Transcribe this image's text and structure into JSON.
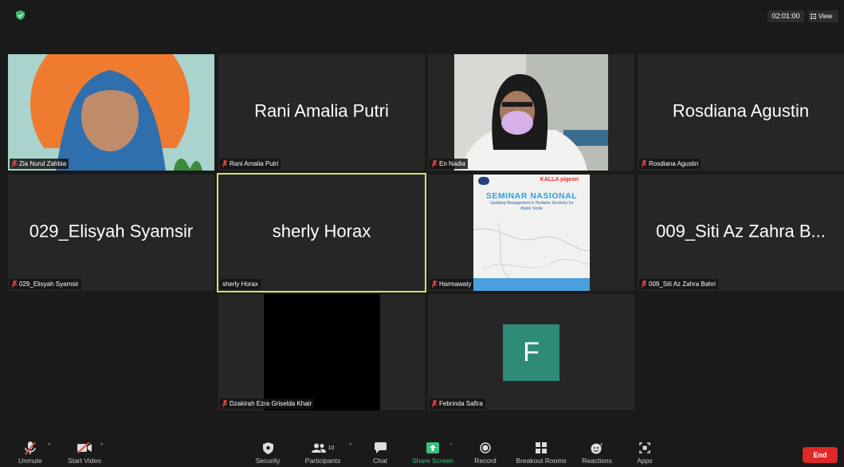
{
  "topbar": {
    "timer": "02:01:00",
    "view_label": "View"
  },
  "tiles": [
    {
      "name": "Zia Nurul Zahbia",
      "big": ""
    },
    {
      "name": "Rani Amalia Putri",
      "big": "Rani Amalia Putri"
    },
    {
      "name": "En Nadia",
      "big": ""
    },
    {
      "name": "Rosdiana Agustin",
      "big": "Rosdiana Agustin"
    },
    {
      "name": "029_Elisyah Syamsir",
      "big": "029_Elisyah Syamsir"
    },
    {
      "name": "sherly Horax",
      "big": "sherly Horax"
    },
    {
      "name": "Harmawaty",
      "big": ""
    },
    {
      "name": "009_Siti Az Zahra Bahri",
      "big": "009_Siti Az Zahra B..."
    },
    {
      "name": "Dzakirah Ezra Griselda Khair",
      "big": ""
    },
    {
      "name": "Febrinda Safira",
      "big": "",
      "avatar_letter": "F"
    }
  ],
  "poster": {
    "brands": "KALLA pigeon",
    "title": "SEMINAR NASIONAL",
    "subtitle": "Updating Management in Pediatric Dentistry for Better Smile"
  },
  "toolbar": {
    "unmute": "Unmute",
    "start_video": "Start Video",
    "security": "Security",
    "participants": "Participants",
    "participants_count": "10",
    "chat": "Chat",
    "share_screen": "Share Screen",
    "record": "Record",
    "breakout": "Breakout Rooms",
    "reactions": "Reactions",
    "apps": "Apps",
    "end": "End"
  },
  "colors": {
    "active_speaker_border": "#d9e26a",
    "share_green": "#39c07a",
    "end_red": "#e02828",
    "avatar_teal": "#2e8b78",
    "shield_green": "#3cb371"
  }
}
